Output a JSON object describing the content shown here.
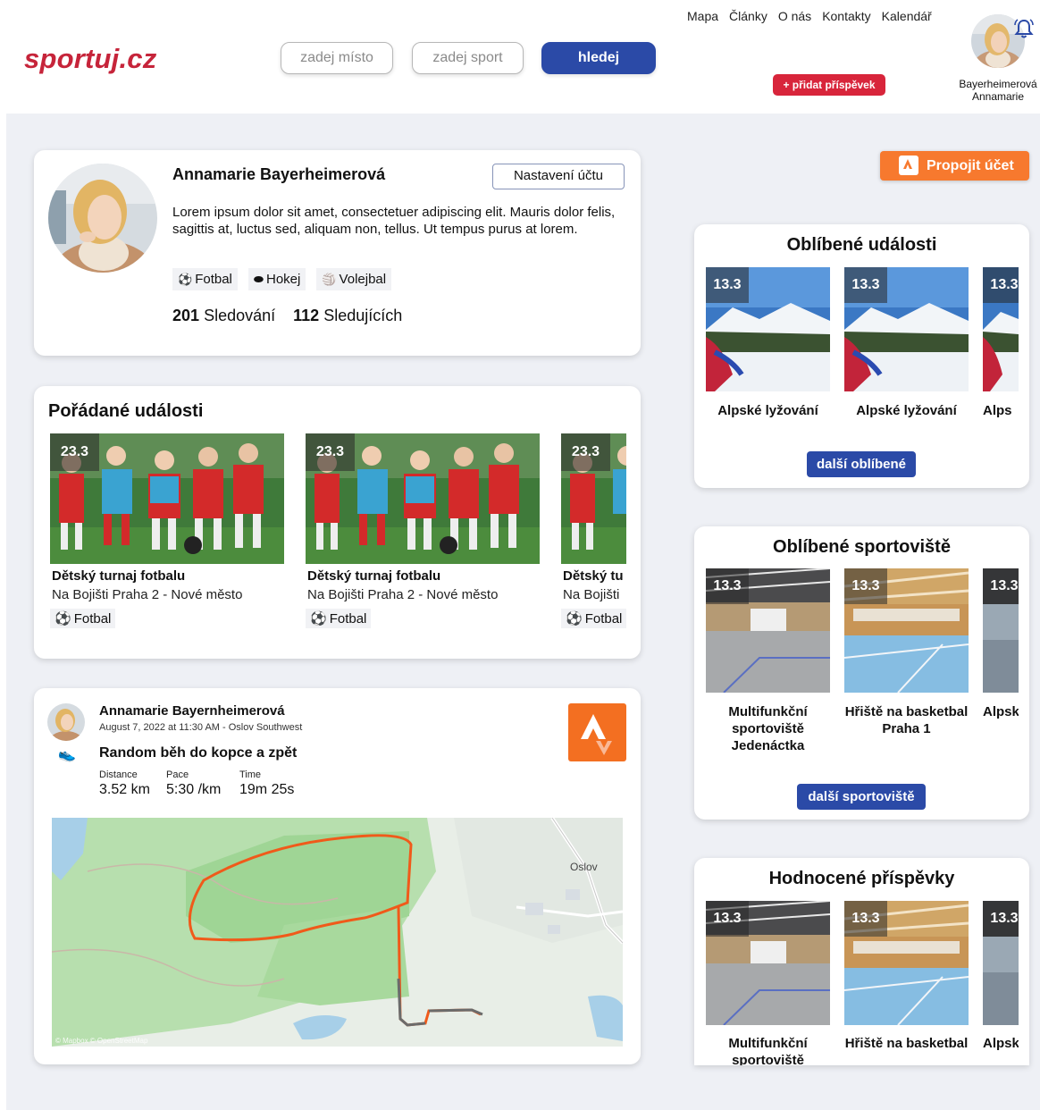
{
  "header": {
    "logo": "sportuj.cz",
    "place_placeholder": "zadej místo",
    "sport_placeholder": "zadej sport",
    "search_label": "hledej",
    "nav": [
      "Mapa",
      "Články",
      "O nás",
      "Kontakty",
      "Kalendář"
    ],
    "add_post": "+ přidat příspěvek",
    "user_name_line1": "Bayerheimerová",
    "user_name_line2": "Annamarie"
  },
  "profile": {
    "name": "Annamarie Bayerheimerová",
    "settings_label": "Nastavení účtu",
    "bio": "Lorem ipsum dolor sit amet, consectetuer adipiscing elit. Mauris dolor felis, sagittis at, luctus sed, aliquam non, tellus. Ut tempus purus at lorem.",
    "tags": [
      "Fotbal",
      "Hokej",
      "Volejbal"
    ],
    "following_count": "201",
    "following_label": "Sledování",
    "followers_count": "112",
    "followers_label": "Sledujících"
  },
  "events": {
    "title": "Pořádané události",
    "items": [
      {
        "date": "23.3",
        "title": "Dětský turnaj fotbalu",
        "place": "Na Bojišti Praha 2 - Nové město",
        "tag": "Fotbal"
      },
      {
        "date": "23.3",
        "title": "Dětský turnaj fotbalu",
        "place": "Na Bojišti Praha 2 - Nové město",
        "tag": "Fotbal"
      },
      {
        "date": "23.3",
        "title": "Dětský tu",
        "place": "Na Bojišti",
        "tag": "Fotbal"
      }
    ]
  },
  "activity": {
    "author": "Annamarie Bayernheimerová",
    "date": "August 7, 2022 at 11:30 AM - Oslov Southwest",
    "title": "Random běh do kopce a zpět",
    "distance_label": "Distance",
    "distance": "3.52 km",
    "pace_label": "Pace",
    "pace": "5:30 /km",
    "time_label": "Time",
    "time": "19m 25s",
    "map_city": "Oslov",
    "map_credit": "© Mapbox © OpenStreetMap"
  },
  "connect_label": "Propojit účet",
  "fav_events": {
    "title": "Oblíbené události",
    "items": [
      {
        "date": "13.3",
        "label": "Alpské lyžování"
      },
      {
        "date": "13.3",
        "label": "Alpské lyžování"
      },
      {
        "date": "13.3",
        "label": "Alps"
      }
    ],
    "more": "další oblíbené"
  },
  "fav_venues": {
    "title": "Oblíbené sportoviště",
    "items": [
      {
        "date": "13.3",
        "label": "Multifunkční sportoviště Jedenáctka"
      },
      {
        "date": "13.3",
        "label": "Hřiště na basketbal Praha 1"
      },
      {
        "date": "13.3",
        "label": "Alpsk"
      }
    ],
    "more": "další sportoviště"
  },
  "rated_posts": {
    "title": "Hodnocené příspěvky",
    "items": [
      {
        "date": "13.3",
        "label": "Multifunkční sportoviště"
      },
      {
        "date": "13.3",
        "label": "Hřiště na basketbal"
      },
      {
        "date": "13.3",
        "label": "Alpsk"
      }
    ]
  },
  "colors": {
    "brand_red": "#c6243a",
    "primary_blue": "#2b4aa7",
    "strava_orange": "#f36f21",
    "route_orange": "#f05a1a"
  }
}
